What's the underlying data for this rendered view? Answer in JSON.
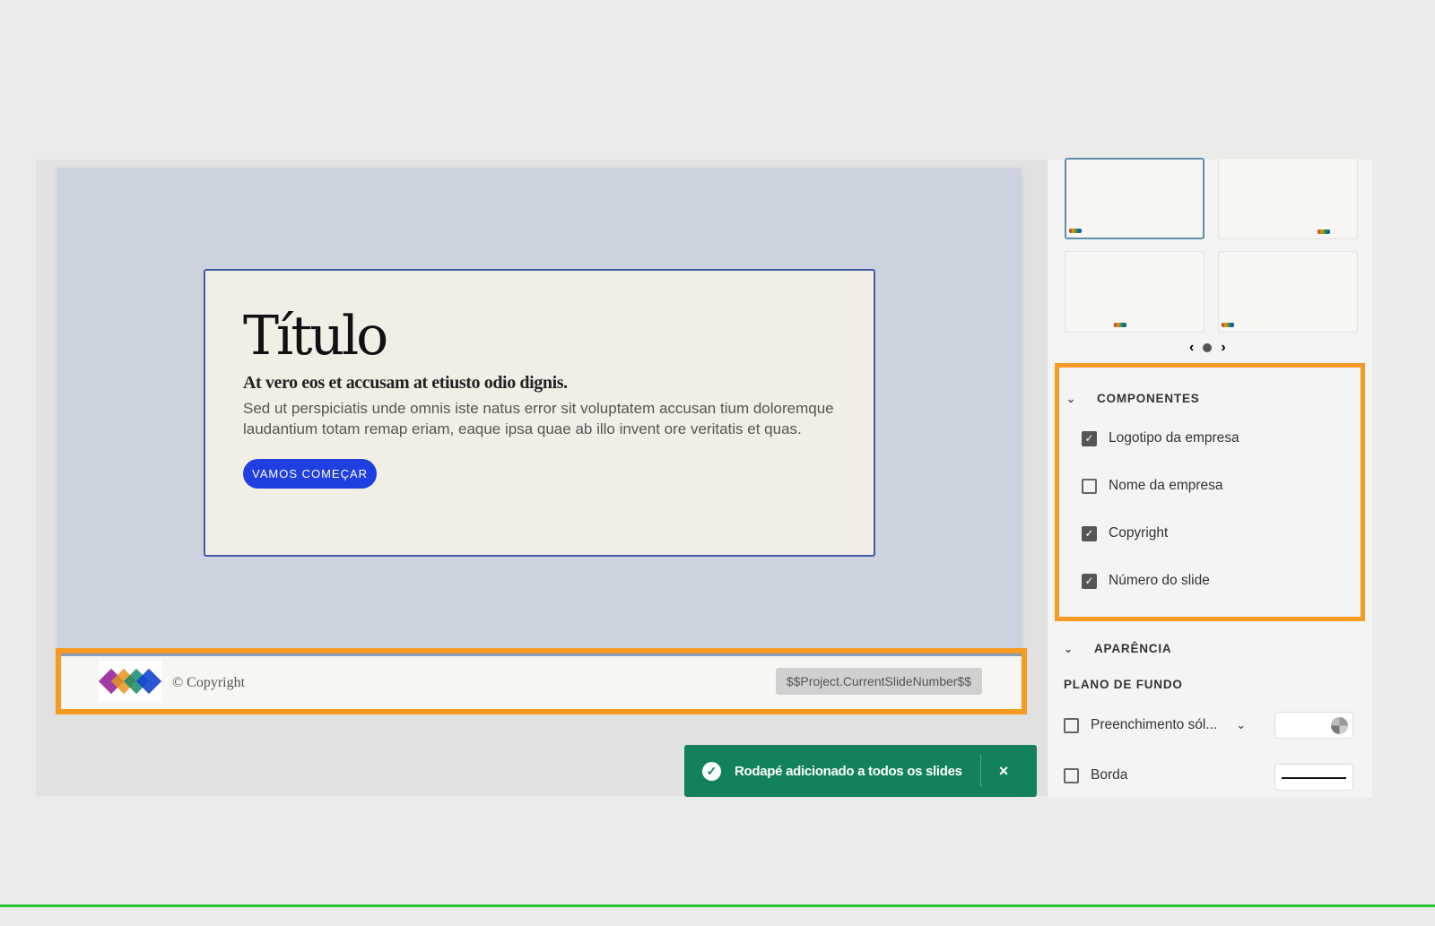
{
  "slide": {
    "title": "Título",
    "subtitle": "At vero eos et accusam at etiusto odio dignis.",
    "body": "Sed ut perspiciatis unde omnis iste natus error sit voluptatem accusan tium doloremque laudantium totam remap eriam, eaque ipsa quae ab illo invent ore veritatis et quas.",
    "cta": "VAMOS COMEÇAR"
  },
  "footer": {
    "copyright": "© Copyright",
    "slide_number": "$$Project.CurrentSlideNumber$$"
  },
  "toast": {
    "message": "Rodapé adicionado a todos os slides",
    "close": "×"
  },
  "panel": {
    "components": {
      "title": "COMPONENTES",
      "items": [
        {
          "label": "Logotipo da empresa",
          "checked": true
        },
        {
          "label": "Nome da empresa",
          "checked": false
        },
        {
          "label": "Copyright",
          "checked": true
        },
        {
          "label": "Número do slide",
          "checked": true
        }
      ]
    },
    "appearance": {
      "title": "APARÊNCIA",
      "background_title": "PLANO DE FUNDO",
      "fill_label": "Preenchimento sól...",
      "border_label": "Borda"
    }
  },
  "colors": {
    "accent": "#f59a23",
    "toast": "#13825a",
    "cta": "#1f3fe0"
  }
}
